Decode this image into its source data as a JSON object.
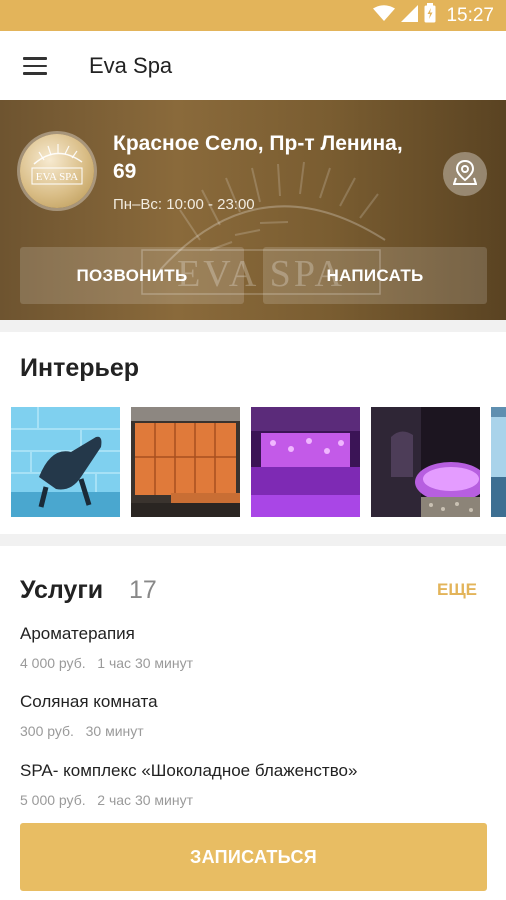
{
  "status_bar": {
    "time": "15:27",
    "icons": [
      "wifi-icon",
      "signal-icon",
      "battery-icon"
    ]
  },
  "app_bar": {
    "title": "Eva Spa",
    "menu_icon": "menu-icon"
  },
  "hero": {
    "logo_text": "EVA SPA",
    "watermark_text": "EVA SPA",
    "address": "Красное Село, Пр-т Ленина, 69",
    "hours": "Пн–Вс: 10:00 - 23:00",
    "call_label": "ПОЗВОНИТЬ",
    "message_label": "НАПИСАТЬ",
    "map_icon": "map-pin-icon"
  },
  "interior": {
    "title": "Интерьер",
    "photos": [
      "salt-room-lounger",
      "orange-lockers",
      "purple-light-pool",
      "dark-jacuzzi",
      "blue-salt-wall"
    ]
  },
  "services": {
    "title": "Услуги",
    "count": "17",
    "more_label": "ЕЩЕ",
    "items": [
      {
        "name": "Ароматерапия",
        "price": "4 000 руб.",
        "duration": "1 час 30 минут"
      },
      {
        "name": "Соляная комната",
        "price": "300 руб.",
        "duration": "30 минут"
      },
      {
        "name": "SPA- комплекс «Шоколадное блаженство»",
        "price": "5 000 руб.",
        "duration": "2 час 30 минут"
      }
    ]
  },
  "book_button": {
    "label": "ЗАПИСАТЬСЯ"
  },
  "colors": {
    "accent": "#e3b45a",
    "button": "#e8bd63",
    "hero": "#7a5d31"
  }
}
